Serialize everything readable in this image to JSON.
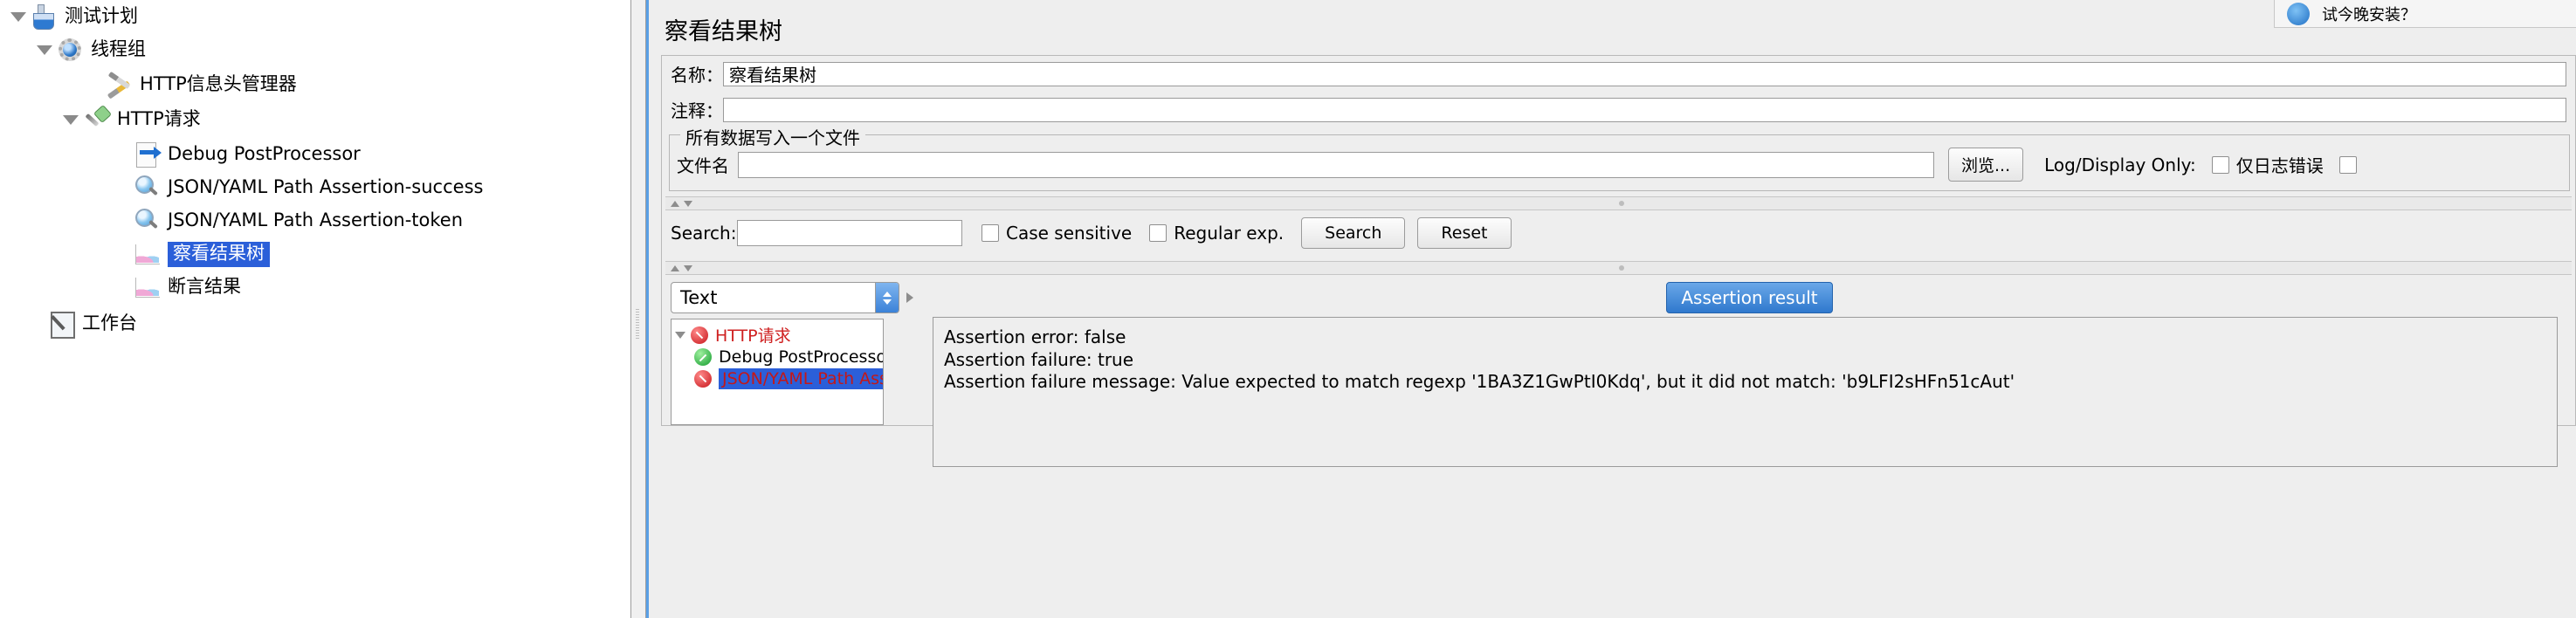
{
  "tree": {
    "nodes": [
      {
        "label": "测试计划",
        "icon": "flask-icon",
        "indent": 0,
        "twisty": true,
        "selected": false
      },
      {
        "label": "线程组",
        "icon": "gear-icon",
        "indent": 1,
        "twisty": true,
        "selected": false
      },
      {
        "label": "HTTP信息头管理器",
        "icon": "tools-icon",
        "indent": 2,
        "twisty": false,
        "selected": false
      },
      {
        "label": "HTTP请求",
        "icon": "pipette-icon",
        "indent": 2,
        "twisty": true,
        "selected": false
      },
      {
        "label": "Debug PostProcessor",
        "icon": "page-arrow-icon",
        "indent": 3,
        "twisty": false,
        "selected": false
      },
      {
        "label": "JSON/YAML Path Assertion-success",
        "icon": "magnifier-icon",
        "indent": 3,
        "twisty": false,
        "selected": false
      },
      {
        "label": "JSON/YAML Path Assertion-token",
        "icon": "magnifier-icon",
        "indent": 3,
        "twisty": false,
        "selected": false
      },
      {
        "label": "察看结果树",
        "icon": "chart-icon",
        "indent": 3,
        "twisty": false,
        "selected": true
      },
      {
        "label": "断言结果",
        "icon": "chart-icon",
        "indent": 3,
        "twisty": false,
        "selected": false
      },
      {
        "label": "工作台",
        "icon": "workbench-icon",
        "indent": 0,
        "twisty": false,
        "selected": false
      }
    ]
  },
  "panel": {
    "title": "察看结果树",
    "name_label": "名称：",
    "name_value": "察看结果树",
    "comment_label": "注释：",
    "comment_value": "",
    "file_group_legend": "所有数据写入一个文件",
    "filename_label": "文件名",
    "filename_value": "",
    "browse_button": "浏览...",
    "log_display_label": "Log/Display Only:",
    "errors_only_label": "仅日志错误",
    "successes_only_label": "",
    "search_label": "Search:",
    "search_value": "",
    "case_sensitive_label": "Case sensitive",
    "regular_exp_label": "Regular exp.",
    "search_button": "Search",
    "reset_button": "Reset",
    "render_selected": "Text"
  },
  "result_tree": {
    "nodes": [
      {
        "label": "HTTP请求",
        "status": "error",
        "selected": false,
        "twisty": true
      },
      {
        "label": "Debug PostProcessor",
        "status": "ok",
        "selected": false,
        "twisty": false
      },
      {
        "label": "JSON/YAML Path Assertion-t",
        "status": "error",
        "selected": true,
        "twisty": false
      }
    ]
  },
  "assertion": {
    "tab_label": "Assertion result",
    "lines": [
      "Assertion error: false",
      "Assertion failure: true",
      "Assertion failure message: Value expected to match regexp '1BA3Z1GwPtI0Kdq', but it did not match: 'b9LFI2sHFn51cAut'"
    ]
  },
  "popup": {
    "text": "试今晚安装？"
  }
}
